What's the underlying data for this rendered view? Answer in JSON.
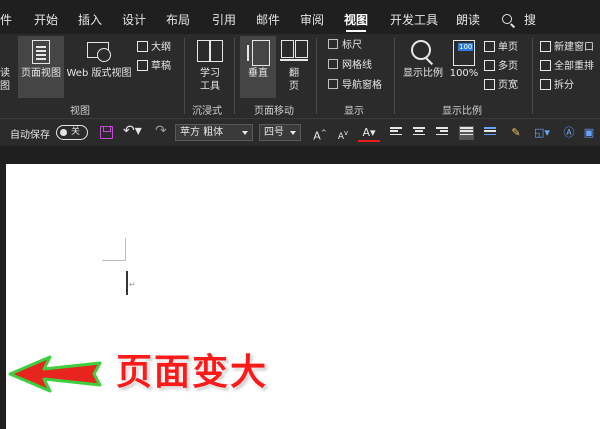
{
  "tabs": [
    {
      "label": "件",
      "active": false
    },
    {
      "label": "开始",
      "active": false
    },
    {
      "label": "插入",
      "active": false
    },
    {
      "label": "设计",
      "active": false
    },
    {
      "label": "布局",
      "active": false
    },
    {
      "label": "引用",
      "active": false
    },
    {
      "label": "邮件",
      "active": false
    },
    {
      "label": "审阅",
      "active": false
    },
    {
      "label": "视图",
      "active": true
    },
    {
      "label": "开发工具",
      "active": false
    },
    {
      "label": "朗读",
      "active": false
    }
  ],
  "search": {
    "label": "搜索",
    "icon": "search-icon"
  },
  "ribbon": {
    "views": {
      "read_mode_line1": "读",
      "read_mode_line2": "图",
      "print_layout": "页面视图",
      "web_layout": "Web 版式视图",
      "outline": "大纲",
      "draft": "草稿",
      "group_label": "视图"
    },
    "immersive": {
      "learning_tools_line1": "学习",
      "learning_tools_line2": "工具",
      "group_label": "沉浸式"
    },
    "page_movement": {
      "vertical": "垂直",
      "side_to_side_line1": "翻",
      "side_to_side_line2": "页",
      "group_label": "页面移动"
    },
    "show": {
      "ruler": "标尺",
      "gridlines": "网格线",
      "navigation_pane": "导航窗格",
      "group_label": "显示"
    },
    "zoom": {
      "zoom": "显示比例",
      "hundred_percent": "100%",
      "hundred_badge": "100",
      "one_page": "单页",
      "multiple_pages": "多页",
      "page_width": "页宽",
      "group_label": "显示比例"
    },
    "window": {
      "new_window": "新建窗口",
      "arrange_all": "全部重排",
      "split": "拆分"
    }
  },
  "qat": {
    "autosave_label": "自动保存",
    "autosave_state": "关",
    "font_name": "苹方 粗体",
    "font_size": "四号"
  },
  "annotation": {
    "text": "页面变大",
    "text_color": "#ff1a1a",
    "arrow_color": "#e8241e",
    "arrow_border": "#3ecf3e"
  }
}
